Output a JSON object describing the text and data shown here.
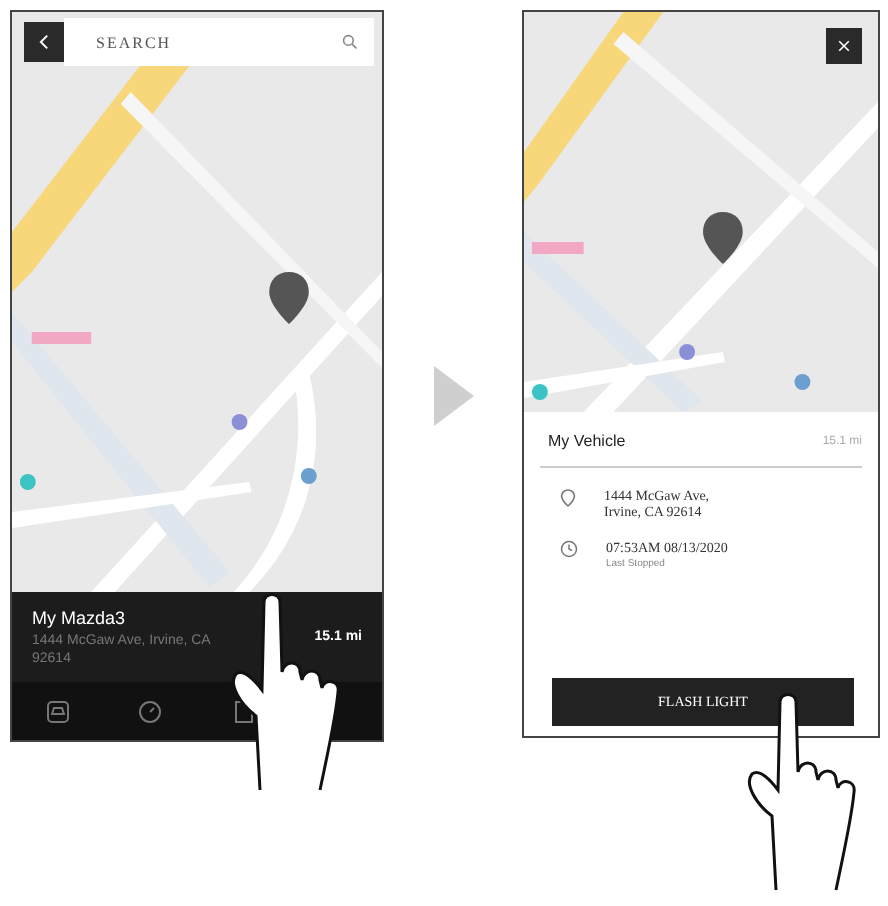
{
  "left_screen": {
    "search": {
      "placeholder": "SEARCH"
    },
    "vehicle": {
      "name": "My Mazda3",
      "address": "1444 McGaw Ave, Irvine, CA 92614",
      "distance": "15.1 mi"
    }
  },
  "right_screen": {
    "title": "My Vehicle",
    "distance": "15.1 mi",
    "address": "1444 McGaw Ave, Irvine, CA 92614",
    "time": "07:53AM 08/13/2020",
    "time_caption": "Last Stopped",
    "button": "FLASH LIGHT"
  }
}
